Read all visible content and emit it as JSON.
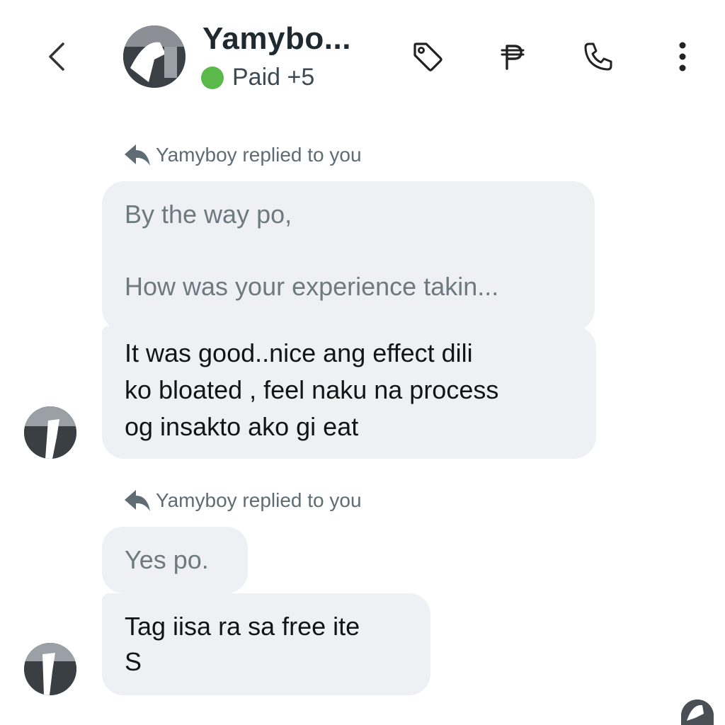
{
  "header": {
    "name": "Yamybo...",
    "status_label": "Paid +5",
    "status_color": "#5bb84a",
    "icons": [
      "back-chevron-icon",
      "tag-icon",
      "peso-icon",
      "phone-icon",
      "more-vertical-icon"
    ]
  },
  "messages": [
    {
      "reply_note": "Yamyboy replied to you",
      "quoted": [
        "By the way po,",
        "How was your experience takin..."
      ],
      "body": [
        "It was good..nice ang effect dili",
        "ko bloated , feel naku na process",
        "og insakto ako gi eat"
      ]
    },
    {
      "reply_note": "Yamyboy replied to you",
      "quoted": [
        "Yes po."
      ],
      "body": [
        "Tag iisa ra sa free ite",
        "S"
      ]
    }
  ]
}
